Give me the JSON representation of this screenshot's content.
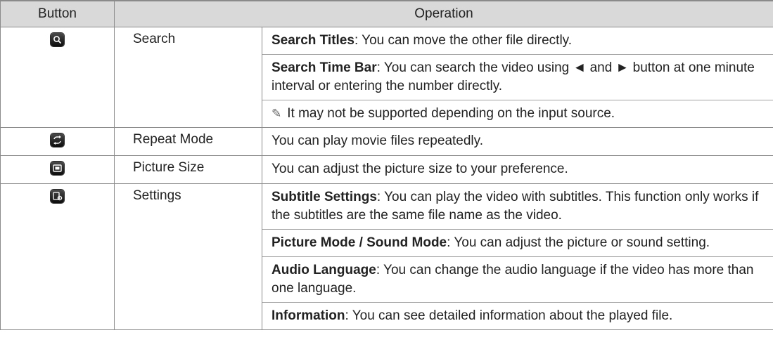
{
  "table": {
    "headers": {
      "button": "Button",
      "operation": "Operation"
    },
    "rows": [
      {
        "icon": "search-icon",
        "name": "Search",
        "paragraphs": [
          {
            "bold": "Search Titles",
            "text": ": You can move the other file directly."
          },
          {
            "bold": "Search Time Bar",
            "text": ": You can search the video using ◄ and ► button at one minute interval or entering the number directly."
          },
          {
            "note_glyph": "✎",
            "text": "It may not be supported depending on the input source."
          }
        ]
      },
      {
        "icon": "repeat-icon",
        "name": "Repeat Mode",
        "paragraphs": [
          {
            "text": "You can play movie files repeatedly."
          }
        ]
      },
      {
        "icon": "picture-size-icon",
        "name": "Picture Size",
        "paragraphs": [
          {
            "text": "You can adjust the picture size to your preference."
          }
        ]
      },
      {
        "icon": "settings-icon",
        "name": "Settings",
        "paragraphs": [
          {
            "bold": "Subtitle Settings",
            "text": ": You can play the video with subtitles. This function only works if the subtitles are the same file name as the video."
          },
          {
            "bold": "Picture Mode / Sound Mode",
            "text": ": You can adjust the picture or sound setting."
          },
          {
            "bold": "Audio Language",
            "text": ": You can change the audio language if the video has more than one language."
          },
          {
            "bold": "Information",
            "text": ": You can see detailed information about the played file."
          }
        ]
      }
    ]
  }
}
